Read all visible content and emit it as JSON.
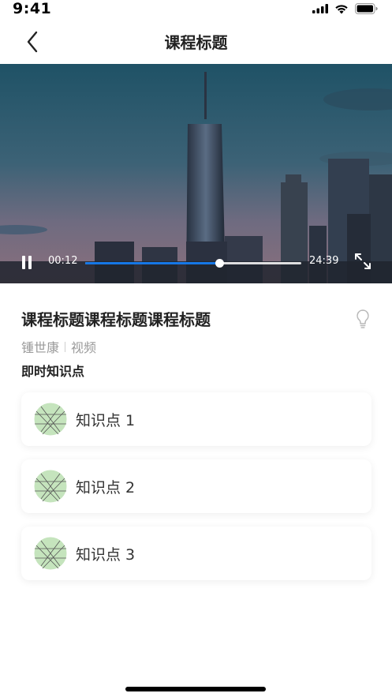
{
  "status_bar": {
    "time": "9:41"
  },
  "nav": {
    "title": "课程标题",
    "back_icon": "chevron-left-icon"
  },
  "player": {
    "current_time": "00:12",
    "total_time": "24:39",
    "progress": 0.62,
    "icons": {
      "pause": "pause-icon",
      "fullscreen": "expand-icon"
    },
    "accent_color": "#1677e6"
  },
  "course": {
    "title": "课程标题课程标题课程标题",
    "teacher": "锺世康",
    "type": "视频",
    "hint_icon": "lightbulb-icon"
  },
  "knowledge": {
    "heading": "即时知识点",
    "items": [
      {
        "label": "知识点 1"
      },
      {
        "label": "知识点 2"
      },
      {
        "label": "知识点 3"
      }
    ]
  }
}
